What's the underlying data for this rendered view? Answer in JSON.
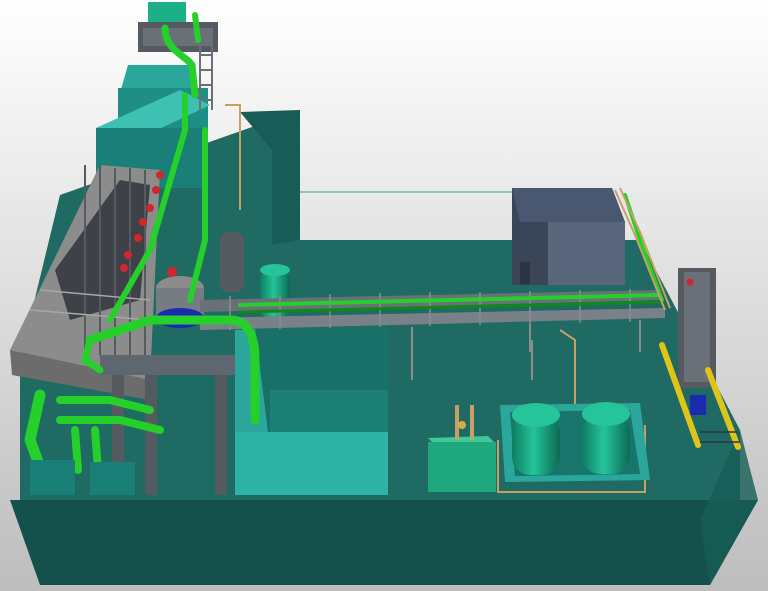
{
  "scene": {
    "colors": {
      "background_top": "#ffffff",
      "background_bottom": "#bdbdbd",
      "slab_top": "#1f6a63",
      "slab_front": "#14514c",
      "slab_side": "#175c56",
      "pipe_green": "#25d02b",
      "pipe_dark": "#0f8a18",
      "steel_grey": "#8c8c8c",
      "steel_dark": "#555a60",
      "tank_green": "#1bb088",
      "tank_dark": "#0e7d60",
      "valve_red": "#d1262c",
      "rail_yellow": "#e0c41a",
      "copper_line": "#c8a064",
      "navy_block": "#3a4657",
      "box_cyan": "#2aa69b"
    },
    "icons": [
      "pipe-icon",
      "tank-icon",
      "valve-icon",
      "ladder-icon",
      "railing-icon"
    ]
  }
}
